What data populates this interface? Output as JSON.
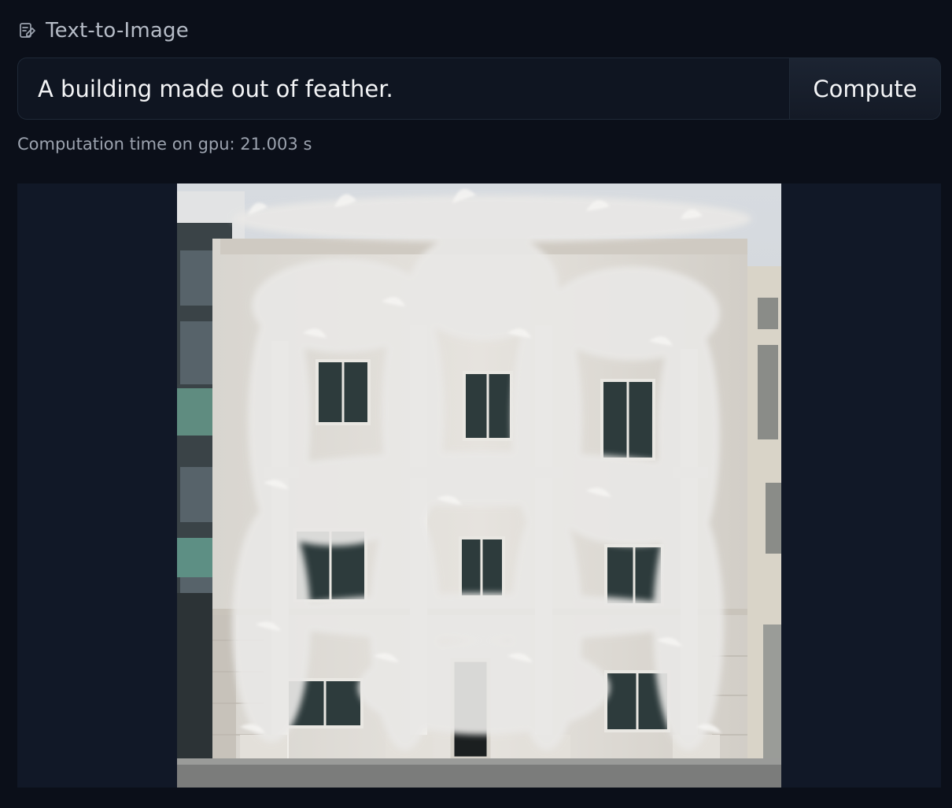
{
  "header": {
    "icon": "edit-note-icon",
    "title": "Text-to-Image"
  },
  "prompt": {
    "value": "A building made out of feather.",
    "button_label": "Compute"
  },
  "status": {
    "text": "Computation time on gpu: 21.003 s"
  },
  "output": {
    "image_alt": "generated image"
  },
  "colors": {
    "background": "#0b0f19",
    "panel": "#111827",
    "text": "#f3f4f6",
    "muted": "#9ca3af"
  }
}
